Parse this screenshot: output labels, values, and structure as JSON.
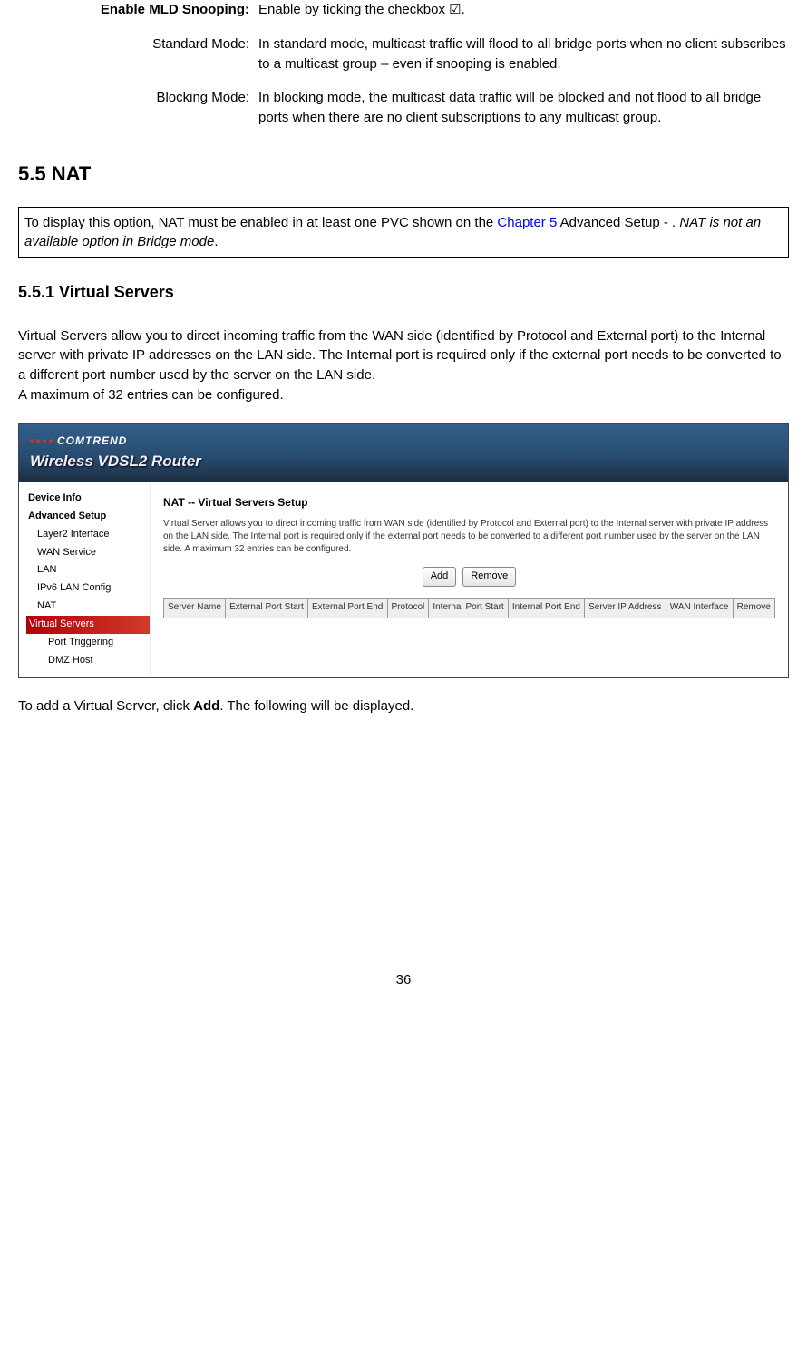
{
  "defs": [
    {
      "label": "Enable MLD Snooping:",
      "bold": true,
      "desc": "Enable by ticking the checkbox ☑."
    },
    {
      "label": "Standard Mode:",
      "bold": false,
      "desc": "In standard mode, multicast traffic will flood to all bridge ports when no client subscribes to a multicast group – even if snooping is enabled."
    },
    {
      "label": "Blocking Mode:",
      "bold": false,
      "desc": "In blocking mode, the multicast data traffic will be blocked and not flood to all bridge ports when there are no client subscriptions to any multicast group."
    }
  ],
  "h2": "5.5  NAT",
  "note": {
    "pre": "To display this option, NAT must be enabled in at least one PVC shown on the ",
    "link": "Chapter 5",
    "mid": " Advanced Setup - . ",
    "italic": "NAT is not an available option in Bridge mode",
    "post": "."
  },
  "h3": "5.5.1    Virtual Servers",
  "para1": "Virtual Servers allow you to direct incoming traffic from the WAN side (identified by Protocol and External port) to the Internal server with private IP addresses on the LAN side. The Internal port is required only if the external port needs to be converted to a different port number used by the server on the LAN side.\nA maximum of 32 entries can be configured.",
  "screenshot": {
    "brand": "COMTREND",
    "product": "Wireless VDSL2 Router",
    "nav": [
      {
        "text": "Device Info",
        "cls": "nav-item"
      },
      {
        "text": "Advanced Setup",
        "cls": "nav-item"
      },
      {
        "text": "Layer2 Interface",
        "cls": "nav-item nav-sub"
      },
      {
        "text": "WAN Service",
        "cls": "nav-item nav-sub"
      },
      {
        "text": "LAN",
        "cls": "nav-item nav-sub"
      },
      {
        "text": "IPv6 LAN Config",
        "cls": "nav-item nav-sub"
      },
      {
        "text": "NAT",
        "cls": "nav-item nav-sub"
      },
      {
        "text": "Virtual Servers",
        "cls": "nav-item nav-sub2 nav-active"
      },
      {
        "text": "Port Triggering",
        "cls": "nav-item nav-sub2"
      },
      {
        "text": "DMZ Host",
        "cls": "nav-item nav-sub2"
      }
    ],
    "main_title": "NAT -- Virtual Servers Setup",
    "main_desc": "Virtual Server allows you to direct incoming traffic from WAN side (identified by Protocol and External port) to the Internal server with private IP address on the LAN side. The Internal port is required only if the external port needs to be converted to a different port number used by the server on the LAN side. A maximum 32 entries can be configured.",
    "btn_add": "Add",
    "btn_remove": "Remove",
    "cols": [
      "Server Name",
      "External Port Start",
      "External Port End",
      "Protocol",
      "Internal Port Start",
      "Internal Port End",
      "Server IP Address",
      "WAN Interface",
      "Remove"
    ]
  },
  "para2_pre": "To add a Virtual Server, click ",
  "para2_bold": "Add",
  "para2_post": ". The following will be displayed.",
  "page_num": "36"
}
